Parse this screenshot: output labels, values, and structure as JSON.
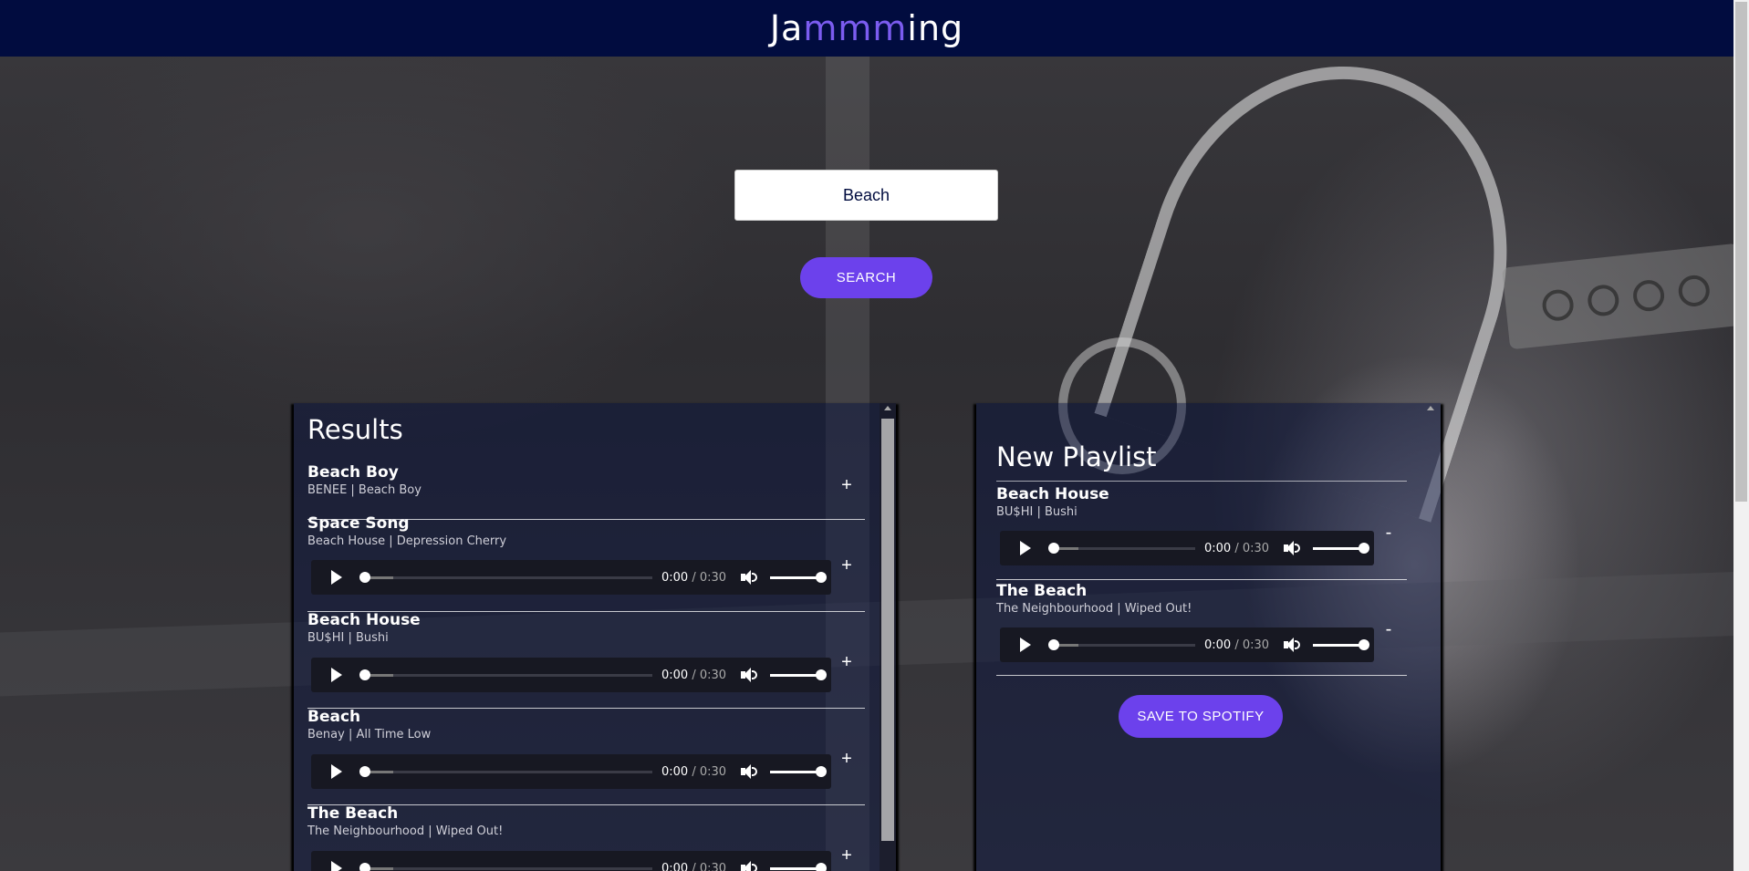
{
  "header": {
    "logo_prefix": "Ja",
    "logo_highlight": "mmm",
    "logo_suffix": "ing",
    "accent_color": "#6c41ec",
    "bar_color": "#010c3f"
  },
  "search": {
    "value": "Beach",
    "button_label": "SEARCH"
  },
  "results": {
    "title": "Results",
    "tracks": [
      {
        "name": "Beach Boy",
        "info": "BENEE | Beach Boy",
        "action": "+",
        "has_preview": false
      },
      {
        "name": "Space Song",
        "info": "Beach House | Depression Cherry",
        "action": "+",
        "has_preview": true,
        "time": "0:00",
        "duration": "/ 0:30"
      },
      {
        "name": "Beach House",
        "info": "BU$HI | Bushi",
        "action": "+",
        "has_preview": true,
        "time": "0:00",
        "duration": "/ 0:30"
      },
      {
        "name": "Beach",
        "info": "Benay | All Time Low",
        "action": "+",
        "has_preview": true,
        "time": "0:00",
        "duration": "/ 0:30"
      },
      {
        "name": "The Beach",
        "info": "The Neighbourhood | Wiped Out!",
        "action": "+",
        "has_preview": true,
        "time": "0:00",
        "duration": "/ 0:30"
      }
    ]
  },
  "playlist": {
    "title": "New Playlist",
    "tracks": [
      {
        "name": "Beach House",
        "info": "BU$HI | Bushi",
        "action": "-",
        "time": "0:00",
        "duration": "/ 0:30"
      },
      {
        "name": "The Beach",
        "info": "The Neighbourhood | Wiped Out!",
        "action": "-",
        "time": "0:00",
        "duration": "/ 0:30"
      }
    ],
    "save_label": "SAVE TO SPOTIFY"
  },
  "icons": {
    "play": "play-icon",
    "volume": "volume-icon",
    "add": "plus-icon",
    "remove": "minus-icon"
  }
}
